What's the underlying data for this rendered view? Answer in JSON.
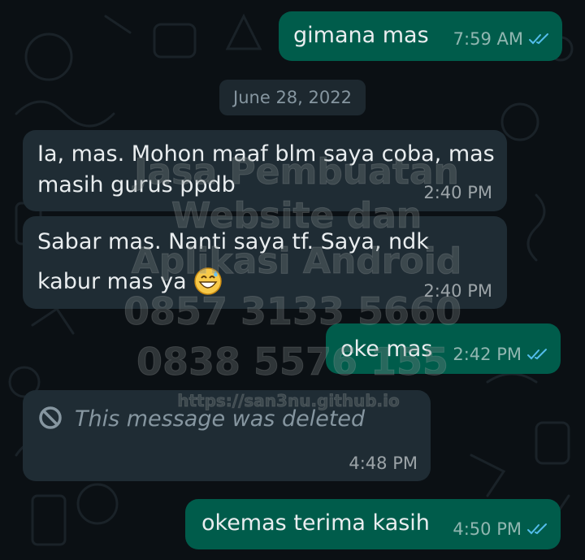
{
  "chat": {
    "date_separator": "June 28, 2022",
    "messages": [
      {
        "id": "m1",
        "direction": "outgoing",
        "lines": [
          "gimana mas"
        ],
        "time": "7:59 AM",
        "status": "read"
      },
      {
        "id": "m2",
        "direction": "incoming",
        "lines": [
          "Ia, mas. Mohon maaf blm saya coba, mas",
          "masih gurus ppdb"
        ],
        "time": "2:40 PM"
      },
      {
        "id": "m3",
        "direction": "incoming",
        "lines": [
          "Sabar mas. Nanti saya tf. Saya, ndk",
          "kabur mas ya"
        ],
        "emoji": "grinning-sweat-face",
        "time": "2:40 PM"
      },
      {
        "id": "m4",
        "direction": "outgoing",
        "lines": [
          "oke mas"
        ],
        "time": "2:42 PM",
        "status": "read"
      },
      {
        "id": "m5",
        "direction": "incoming",
        "deleted": true,
        "lines": [
          "This message was deleted"
        ],
        "time": "4:48 PM",
        "icon": "ban-icon"
      },
      {
        "id": "m6",
        "direction": "outgoing",
        "lines": [
          "okemas terima kasih"
        ],
        "time": "4:50 PM",
        "status": "read"
      }
    ]
  },
  "watermark": {
    "lines": [
      "Jasa Pembuatan",
      "Website dan",
      "Aplikasi Android",
      "0857 3133 5660",
      "0838 5576 155",
      "https://san3nu.github.io"
    ]
  },
  "colors": {
    "background": "#0b1014",
    "outgoing_bubble": "#005c4b",
    "incoming_bubble": "#1f2c34",
    "read_ticks": "#53bdeb",
    "text": "#e9edef",
    "meta_text": "#8696a0"
  }
}
